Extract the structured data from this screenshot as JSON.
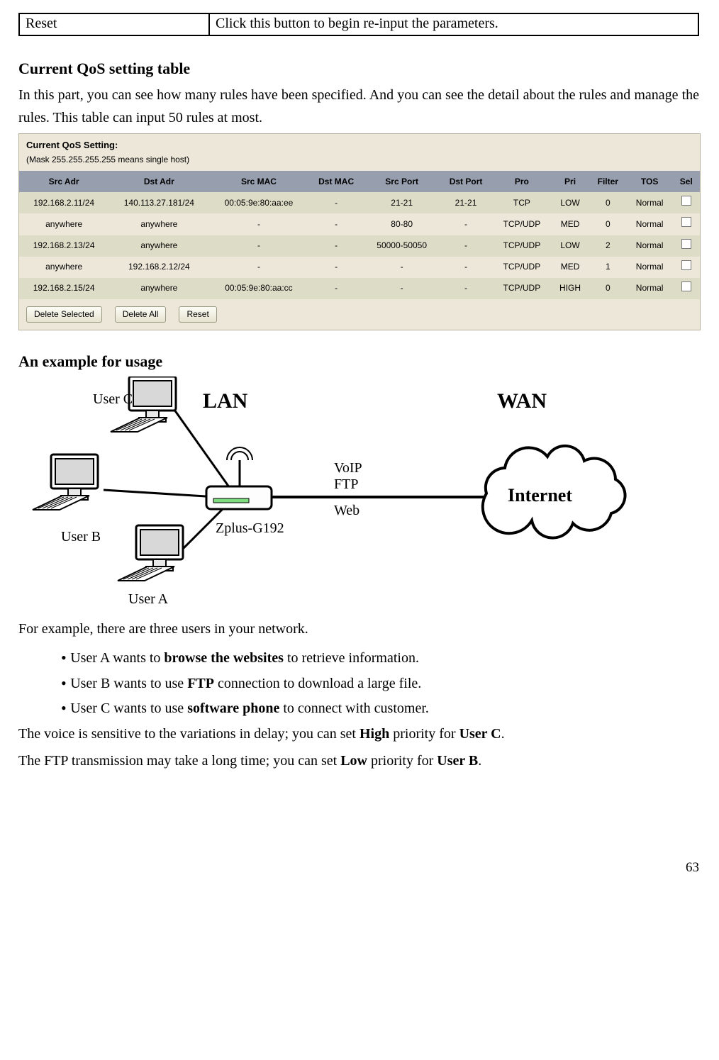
{
  "param_row": {
    "left": "Reset",
    "right": "Click this button to begin re-input the parameters."
  },
  "section1": {
    "title": "Current QoS setting table",
    "para": "In this part, you can see how many rules have been specified. And you can see the detail about the rules and manage the rules. This table can input 50 rules at most."
  },
  "qos_panel": {
    "title": "Current QoS Setting:",
    "subtitle": "(Mask 255.255.255.255 means single host)",
    "headers": [
      "Src Adr",
      "Dst Adr",
      "Src MAC",
      "Dst MAC",
      "Src Port",
      "Dst Port",
      "Pro",
      "Pri",
      "Filter",
      "TOS",
      "Sel"
    ],
    "rows": [
      {
        "src": "192.168.2.11/24",
        "dst": "140.113.27.181/24",
        "smac": "00:05:9e:80:aa:ee",
        "dmac": "-",
        "sport": "21-21",
        "dport": "21-21",
        "pro": "TCP",
        "pri": "LOW",
        "fil": "0",
        "tos": "Normal"
      },
      {
        "src": "anywhere",
        "dst": "anywhere",
        "smac": "-",
        "dmac": "-",
        "sport": "80-80",
        "dport": "-",
        "pro": "TCP/UDP",
        "pri": "MED",
        "fil": "0",
        "tos": "Normal"
      },
      {
        "src": "192.168.2.13/24",
        "dst": "anywhere",
        "smac": "-",
        "dmac": "-",
        "sport": "50000-50050",
        "dport": "-",
        "pro": "TCP/UDP",
        "pri": "LOW",
        "fil": "2",
        "tos": "Normal"
      },
      {
        "src": "anywhere",
        "dst": "192.168.2.12/24",
        "smac": "-",
        "dmac": "-",
        "sport": "-",
        "dport": "-",
        "pro": "TCP/UDP",
        "pri": "MED",
        "fil": "1",
        "tos": "Normal"
      },
      {
        "src": "192.168.2.15/24",
        "dst": "anywhere",
        "smac": "00:05:9e:80:aa:cc",
        "dmac": "-",
        "sport": "-",
        "dport": "-",
        "pro": "TCP/UDP",
        "pri": "HIGH",
        "fil": "0",
        "tos": "Normal"
      }
    ],
    "buttons": {
      "del_sel": "Delete Selected",
      "del_all": "Delete All",
      "reset": "Reset"
    }
  },
  "section2": {
    "title": "An example for usage"
  },
  "diagram": {
    "lan": "LAN",
    "wan": "WAN",
    "internet": "Internet",
    "user_a": "User A",
    "user_b": "User B",
    "user_c": "User C",
    "router": "Zplus-G192",
    "link1": "VoIP",
    "link2": "FTP",
    "link3": "Web"
  },
  "example": {
    "intro": "For example, there are three users in your network.",
    "li1_a": "User A wants to ",
    "li1_b": "browse the websites",
    "li1_c": " to retrieve information.",
    "li2_a": "User B wants to use ",
    "li2_b": "FTP",
    "li2_c": " connection to download a large file.",
    "li3_a": "User C wants to use ",
    "li3_b": "software phone",
    "li3_c": " to connect with customer.",
    "p1_a": "The voice is sensitive to the variations in delay; you can set ",
    "p1_b": "High",
    "p1_c": " priority for ",
    "p1_d": "User C",
    "p1_e": ".",
    "p2_a": "The FTP transmission may take a long time; you can set ",
    "p2_b": "Low",
    "p2_c": " priority for ",
    "p2_d": "User B",
    "p2_e": "."
  },
  "page_number": "63"
}
